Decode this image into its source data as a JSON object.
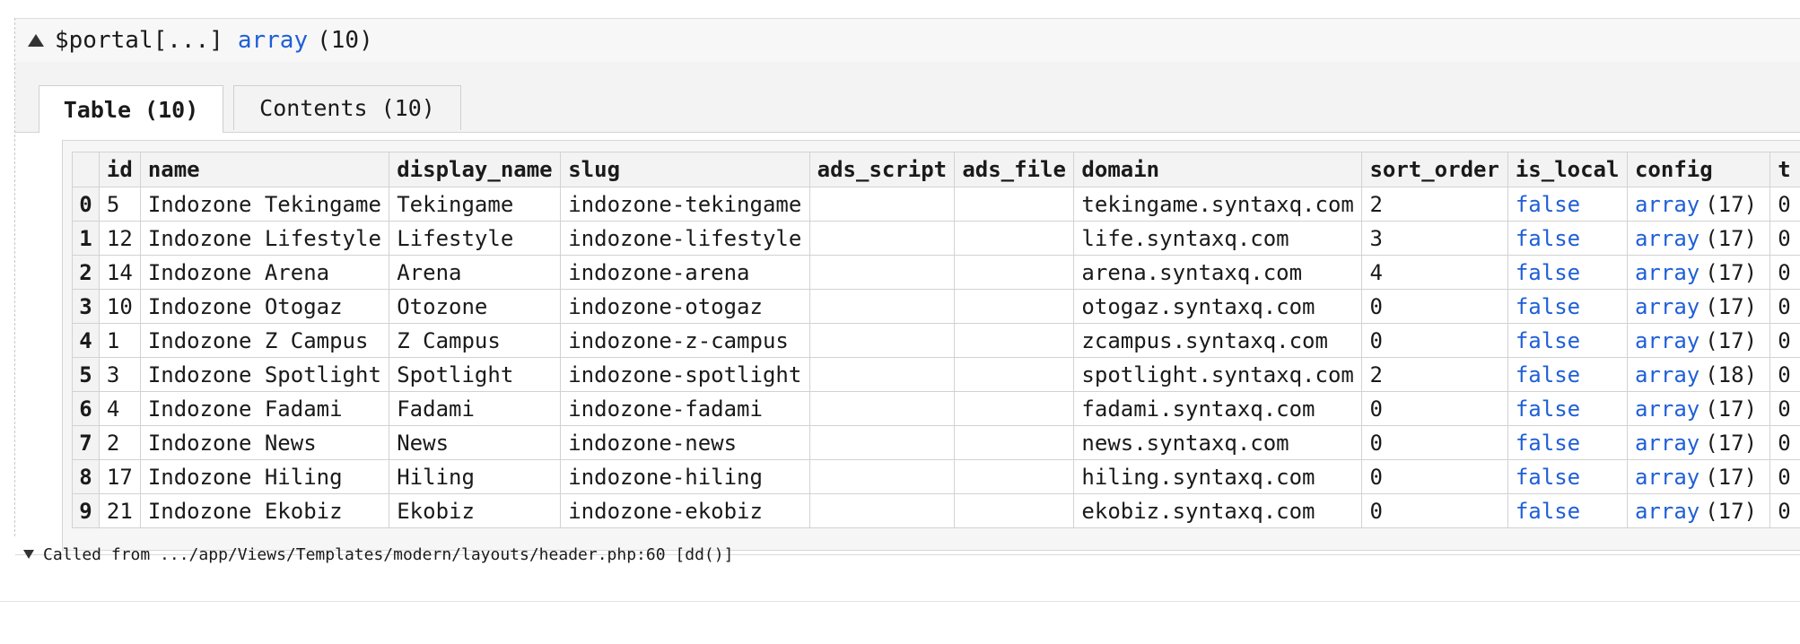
{
  "header": {
    "var_name": "$portal[...]",
    "type_label": "array",
    "count": "(10)"
  },
  "tabs": [
    {
      "label": "Table (10)",
      "active": true
    },
    {
      "label": "Contents (10)",
      "active": false
    }
  ],
  "table": {
    "columns": [
      "",
      "id",
      "name",
      "display_name",
      "slug",
      "ads_script",
      "ads_file",
      "domain",
      "sort_order",
      "is_local",
      "config",
      "t"
    ],
    "rows": [
      {
        "idx": "0",
        "id": "5",
        "name": "Indozone Tekingame",
        "display_name": "Tekingame",
        "slug": "indozone-tekingame",
        "ads_script": "",
        "ads_file": "",
        "domain": "tekingame.syntaxq.com",
        "sort_order": "2",
        "is_local": "false",
        "config_type": "array",
        "config_count": "(17)",
        "t": "0"
      },
      {
        "idx": "1",
        "id": "12",
        "name": "Indozone Lifestyle",
        "display_name": "Lifestyle",
        "slug": "indozone-lifestyle",
        "ads_script": "",
        "ads_file": "",
        "domain": "life.syntaxq.com",
        "sort_order": "3",
        "is_local": "false",
        "config_type": "array",
        "config_count": "(17)",
        "t": "0"
      },
      {
        "idx": "2",
        "id": "14",
        "name": "Indozone Arena",
        "display_name": "Arena",
        "slug": "indozone-arena",
        "ads_script": "",
        "ads_file": "",
        "domain": "arena.syntaxq.com",
        "sort_order": "4",
        "is_local": "false",
        "config_type": "array",
        "config_count": "(17)",
        "t": "0"
      },
      {
        "idx": "3",
        "id": "10",
        "name": "Indozone Otogaz",
        "display_name": "Otozone",
        "slug": "indozone-otogaz",
        "ads_script": "",
        "ads_file": "",
        "domain": "otogaz.syntaxq.com",
        "sort_order": "0",
        "is_local": "false",
        "config_type": "array",
        "config_count": "(17)",
        "t": "0"
      },
      {
        "idx": "4",
        "id": "1",
        "name": "Indozone Z Campus",
        "display_name": "Z Campus",
        "slug": "indozone-z-campus",
        "ads_script": "",
        "ads_file": "",
        "domain": "zcampus.syntaxq.com",
        "sort_order": "0",
        "is_local": "false",
        "config_type": "array",
        "config_count": "(17)",
        "t": "0"
      },
      {
        "idx": "5",
        "id": "3",
        "name": "Indozone Spotlight",
        "display_name": "Spotlight",
        "slug": "indozone-spotlight",
        "ads_script": "",
        "ads_file": "",
        "domain": "spotlight.syntaxq.com",
        "sort_order": "2",
        "is_local": "false",
        "config_type": "array",
        "config_count": "(18)",
        "t": "0"
      },
      {
        "idx": "6",
        "id": "4",
        "name": "Indozone Fadami",
        "display_name": "Fadami",
        "slug": "indozone-fadami",
        "ads_script": "",
        "ads_file": "",
        "domain": "fadami.syntaxq.com",
        "sort_order": "0",
        "is_local": "false",
        "config_type": "array",
        "config_count": "(17)",
        "t": "0"
      },
      {
        "idx": "7",
        "id": "2",
        "name": "Indozone News",
        "display_name": "News",
        "slug": "indozone-news",
        "ads_script": "",
        "ads_file": "",
        "domain": "news.syntaxq.com",
        "sort_order": "0",
        "is_local": "false",
        "config_type": "array",
        "config_count": "(17)",
        "t": "0"
      },
      {
        "idx": "8",
        "id": "17",
        "name": "Indozone Hiling",
        "display_name": "Hiling",
        "slug": "indozone-hiling",
        "ads_script": "",
        "ads_file": "",
        "domain": "hiling.syntaxq.com",
        "sort_order": "0",
        "is_local": "false",
        "config_type": "array",
        "config_count": "(17)",
        "t": "0"
      },
      {
        "idx": "9",
        "id": "21",
        "name": "Indozone Ekobiz",
        "display_name": "Ekobiz",
        "slug": "indozone-ekobiz",
        "ads_script": "",
        "ads_file": "",
        "domain": "ekobiz.syntaxq.com",
        "sort_order": "0",
        "is_local": "false",
        "config_type": "array",
        "config_count": "(17)",
        "t": "0"
      }
    ]
  },
  "footer": {
    "text": "Called from .../app/Views/Templates/modern/layouts/header.php:60 [dd()]"
  },
  "icons": {
    "collapse": "triangle-up-icon",
    "expand": "triangle-down-icon"
  },
  "colors": {
    "keyword": "#1f5fd6"
  }
}
